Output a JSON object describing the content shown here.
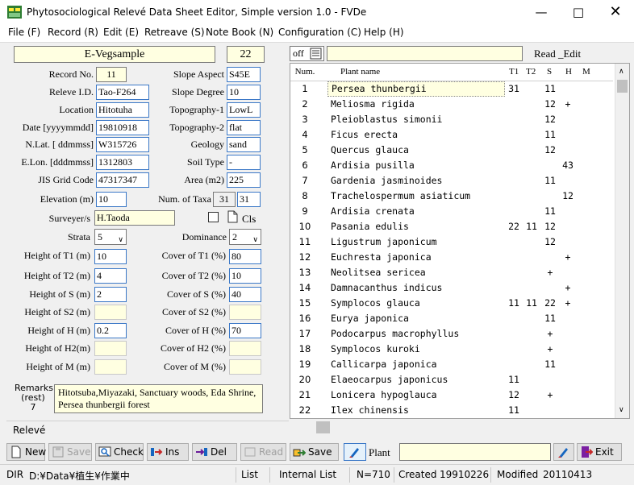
{
  "window": {
    "title": "Phytosociological Relevé Data Sheet Editor, Simple version 1.0 -  FVDe"
  },
  "menu": [
    "File (F)",
    "Record (R)",
    "Edit (E)",
    "Retreave (S)",
    "Note Book (N)",
    "Configuration (C)",
    "Help (H)"
  ],
  "header": {
    "name": "E-Vegsample",
    "count": "22"
  },
  "off_label": "off",
  "read_edit": "Read _Edit",
  "fields": {
    "record_no": {
      "label": "Record No.",
      "value": "11"
    },
    "releve_id": {
      "label": "Releve I.D.",
      "value": "Tao-F264"
    },
    "location": {
      "label": "Location",
      "value": "Hitotuha"
    },
    "date": {
      "label": "Date [yyyymmdd]",
      "value": "19810918"
    },
    "nlat": {
      "label": "N.Lat.  [ ddmmss]",
      "value": "W315726"
    },
    "elon": {
      "label": "E.Lon. [dddmmss]",
      "value": "1312803"
    },
    "jis": {
      "label": "JIS Grid Code",
      "value": "47317347"
    },
    "elevation": {
      "label": "Elevation (m)",
      "value": "10"
    },
    "slope_aspect": {
      "label": "Slope Aspect",
      "value": "S45E"
    },
    "slope_degree": {
      "label": "Slope Degree",
      "value": "10"
    },
    "topo1": {
      "label": "Topography-1",
      "value": "LowL"
    },
    "topo2": {
      "label": "Topography-2",
      "value": "flat"
    },
    "geology": {
      "label": "Geology",
      "value": "sand"
    },
    "soil": {
      "label": "Soil Type",
      "value": "-"
    },
    "area": {
      "label": "Area (m2)",
      "value": "225"
    },
    "taxa": {
      "label": "Num. of Taxa",
      "value1": "31",
      "value2": "31"
    },
    "surveyer": {
      "label": "Surveyer/s",
      "value": "H.Taoda"
    },
    "cls": "Cls",
    "strata": {
      "label": "Strata",
      "value": "5"
    },
    "dominance": {
      "label": "Dominance",
      "value": "2"
    },
    "ht1": {
      "label": "Height of T1 (m)",
      "value": "10"
    },
    "ht2": {
      "label": "Height of T2 (m)",
      "value": "4"
    },
    "hs": {
      "label": "Height of S  (m)",
      "value": "2"
    },
    "hs2": {
      "label": "Height of S2 (m)",
      "value": ""
    },
    "hh": {
      "label": "Height of H  (m)",
      "value": "0.2"
    },
    "hh2": {
      "label": "Height of H2(m)",
      "value": ""
    },
    "hm": {
      "label": "Height of M  (m)",
      "value": ""
    },
    "ct1": {
      "label": "Cover of T1 (%)",
      "value": "80"
    },
    "ct2": {
      "label": "Cover of T2 (%)",
      "value": "10"
    },
    "cs": {
      "label": "Cover of S  (%)",
      "value": "40"
    },
    "cs2": {
      "label": "Cover of S2 (%)",
      "value": ""
    },
    "ch": {
      "label": "Cover of H  (%)",
      "value": "70"
    },
    "ch2": {
      "label": "Cover of H2 (%)",
      "value": ""
    },
    "cm": {
      "label": "Cover of M  (%)",
      "value": ""
    },
    "remarks_label1": "Remarks",
    "remarks_label2": "(rest)",
    "remarks_count": "7",
    "remarks": "Hitotsuba,Miyazaki, Sanctuary woods, Eda Shrine, Persea thunbergii forest"
  },
  "table": {
    "headers": {
      "num": "Num.",
      "name": "Plant name",
      "t1": "T1",
      "t2": "T2",
      "s": "S",
      "h": "H",
      "m": "M"
    },
    "rows": [
      {
        "num": "1",
        "name": "Persea thunbergii",
        "t1": "31",
        "t2": "",
        "s": "11",
        "h": "",
        "m": ""
      },
      {
        "num": "2",
        "name": "Meliosma rigida",
        "t1": "",
        "t2": "",
        "s": "12",
        "h": "+",
        "m": ""
      },
      {
        "num": "3",
        "name": "Pleioblastus simonii",
        "t1": "",
        "t2": "",
        "s": "12",
        "h": "",
        "m": ""
      },
      {
        "num": "4",
        "name": "Ficus erecta",
        "t1": "",
        "t2": "",
        "s": "11",
        "h": "",
        "m": ""
      },
      {
        "num": "5",
        "name": "Quercus glauca",
        "t1": "",
        "t2": "",
        "s": "12",
        "h": "",
        "m": ""
      },
      {
        "num": "6",
        "name": "Ardisia pusilla",
        "t1": "",
        "t2": "",
        "s": "",
        "h": "43",
        "m": ""
      },
      {
        "num": "7",
        "name": "Gardenia jasminoides",
        "t1": "",
        "t2": "",
        "s": "11",
        "h": "",
        "m": ""
      },
      {
        "num": "8",
        "name": "Trachelospermum asiaticum",
        "t1": "",
        "t2": "",
        "s": "",
        "h": "12",
        "m": ""
      },
      {
        "num": "9",
        "name": "Ardisia crenata",
        "t1": "",
        "t2": "",
        "s": "11",
        "h": "",
        "m": ""
      },
      {
        "num": "10",
        "name": "Pasania edulis",
        "t1": "22",
        "t2": "11",
        "s": "12",
        "h": "",
        "m": ""
      },
      {
        "num": "11",
        "name": "Ligustrum japonicum",
        "t1": "",
        "t2": "",
        "s": "12",
        "h": "",
        "m": ""
      },
      {
        "num": "12",
        "name": "Euchresta japonica",
        "t1": "",
        "t2": "",
        "s": "",
        "h": "+",
        "m": ""
      },
      {
        "num": "13",
        "name": "Neolitsea sericea",
        "t1": "",
        "t2": "",
        "s": "+",
        "h": "",
        "m": ""
      },
      {
        "num": "14",
        "name": "Damnacanthus indicus",
        "t1": "",
        "t2": "",
        "s": "",
        "h": "+",
        "m": ""
      },
      {
        "num": "15",
        "name": "Symplocos glauca",
        "t1": "11",
        "t2": "11",
        "s": "22",
        "h": "+",
        "m": ""
      },
      {
        "num": "16",
        "name": "Eurya japonica",
        "t1": "",
        "t2": "",
        "s": "11",
        "h": "",
        "m": ""
      },
      {
        "num": "17",
        "name": "Podocarpus macrophyllus",
        "t1": "",
        "t2": "",
        "s": "+",
        "h": "",
        "m": ""
      },
      {
        "num": "18",
        "name": "Symplocos kuroki",
        "t1": "",
        "t2": "",
        "s": "+",
        "h": "",
        "m": ""
      },
      {
        "num": "19",
        "name": "Callicarpa japonica",
        "t1": "",
        "t2": "",
        "s": "11",
        "h": "",
        "m": ""
      },
      {
        "num": "20",
        "name": "Elaeocarpus japonicus",
        "t1": "11",
        "t2": "",
        "s": "",
        "h": "",
        "m": ""
      },
      {
        "num": "21",
        "name": "Lonicera hypoglauca",
        "t1": "12",
        "t2": "",
        "s": "+",
        "h": "",
        "m": ""
      },
      {
        "num": "22",
        "name": "Ilex chinensis",
        "t1": "11",
        "t2": "",
        "s": "",
        "h": "",
        "m": ""
      }
    ]
  },
  "tab_label": "Relevé",
  "toolbar": {
    "new": "New",
    "save": "Save",
    "check": "Check",
    "ins": "Ins",
    "del": "Del",
    "read": "Read",
    "save2": "Save",
    "plant": "Plant",
    "exit": "Exit"
  },
  "status": {
    "dir_label": "DIR",
    "dir": "D:¥Data¥植生¥作業中",
    "list": "List",
    "internal": "Internal List",
    "count": "N=710",
    "created_label": "Created",
    "created": "19910226",
    "modified_label": "Modified",
    "modified": "20110413"
  },
  "colors": {
    "field_border": "#3b78c7",
    "yellow": "#ffffe1"
  }
}
